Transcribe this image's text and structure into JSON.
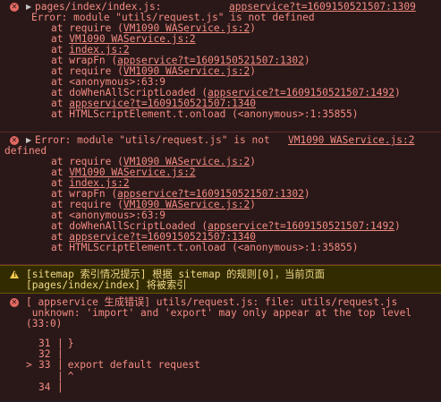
{
  "entries": [
    {
      "type": "error",
      "header_file": "pages/index/index.js:",
      "header_source": "appservice?t=1609150521507:1309",
      "message": "Error: module \"utils/request.js\" is not defined",
      "stack": [
        {
          "prefix": "at require (",
          "link": "VM1090 WAService.js:2",
          "suffix": ")"
        },
        {
          "prefix": "at ",
          "link": "VM1090 WAService.js:2",
          "suffix": ""
        },
        {
          "prefix": "at ",
          "link": "index.js:2",
          "suffix": ""
        },
        {
          "prefix": "at wrapFn (",
          "link": "appservice?t=1609150521507:1302",
          "suffix": ")"
        },
        {
          "prefix": "at require (",
          "link": "VM1090 WAService.js:2",
          "suffix": ")"
        },
        {
          "prefix": "at <anonymous>:63:9",
          "link": "",
          "suffix": ""
        },
        {
          "prefix": "at doWhenAllScriptLoaded (",
          "link": "appservice?t=1609150521507:1492",
          "suffix": ")"
        },
        {
          "prefix": "at ",
          "link": "appservice?t=1609150521507:1340",
          "suffix": ""
        },
        {
          "prefix": "at HTMLScriptElement.t.onload (<anonymous>:1:35855)",
          "link": "",
          "suffix": ""
        }
      ]
    },
    {
      "type": "error",
      "message_line1": "Error: module \"utils/request.js\" is not",
      "message_line2": "defined",
      "source": "VM1090 WAService.js:2",
      "stack": [
        {
          "prefix": "at require (",
          "link": "VM1090 WAService.js:2",
          "suffix": ")"
        },
        {
          "prefix": "at ",
          "link": "VM1090 WAService.js:2",
          "suffix": ""
        },
        {
          "prefix": "at ",
          "link": "index.js:2",
          "suffix": ""
        },
        {
          "prefix": "at wrapFn (",
          "link": "appservice?t=1609150521507:1302",
          "suffix": ")"
        },
        {
          "prefix": "at require (",
          "link": "VM1090 WAService.js:2",
          "suffix": ")"
        },
        {
          "prefix": "at <anonymous>:63:9",
          "link": "",
          "suffix": ""
        },
        {
          "prefix": "at doWhenAllScriptLoaded (",
          "link": "appservice?t=1609150521507:1492",
          "suffix": ")"
        },
        {
          "prefix": "at ",
          "link": "appservice?t=1609150521507:1340",
          "suffix": ""
        },
        {
          "prefix": "at HTMLScriptElement.t.onload (<anonymous>:1:35855)",
          "link": "",
          "suffix": ""
        }
      ]
    },
    {
      "type": "warning",
      "line1": "[sitemap 索引情况提示] 根据 sitemap 的规则[0]，当前页面",
      "line2": "[pages/index/index] 将被索引"
    },
    {
      "type": "error",
      "line1": "[ appservice 生成错误] utils/request.js: file: utils/request.js",
      "line2": " unknown: 'import' and 'export' may only appear at the top level",
      "line3": "(33:0)",
      "code_lines": [
        {
          "marker": "  ",
          "num": "31",
          "bar": "|",
          "code": " }"
        },
        {
          "marker": "  ",
          "num": "32",
          "bar": "|",
          "code": ""
        },
        {
          "marker": "> ",
          "num": "33",
          "bar": "|",
          "code": " export default request"
        },
        {
          "marker": "  ",
          "num": "  ",
          "bar": "|",
          "code": " ^"
        },
        {
          "marker": "  ",
          "num": "34",
          "bar": "|",
          "code": ""
        }
      ]
    }
  ]
}
